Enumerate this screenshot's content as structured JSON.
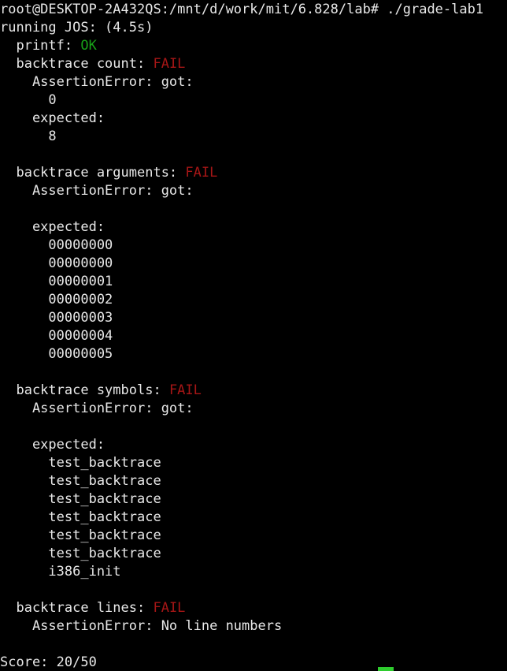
{
  "terminal": {
    "background_color": "#000000",
    "foreground_color": "#e8e8e8",
    "ok_color": "#18a018",
    "fail_color": "#a61616",
    "cursor_color": "#2ecc2e",
    "prompt": {
      "user": "root",
      "host": "DESKTOP-2A432QS",
      "path": "/mnt/d/work/mit/6.828/lab",
      "symbol": "#",
      "command": "./grade-lab1",
      "full_line": "root@DESKTOP-2A432QS:/mnt/d/work/mit/6.828/lab# ./grade-lab1"
    },
    "run_header": "running JOS: (4.5s)",
    "lines": [
      {
        "text": "root@DESKTOP-2A432QS:/mnt/d/work/mit/6.828/lab# ./grade-lab1",
        "style": "plain"
      },
      {
        "text": "running JOS: (4.5s)",
        "style": "plain"
      },
      {
        "text": "  printf: ",
        "status": "OK",
        "style": "ok"
      },
      {
        "text": "  backtrace count: ",
        "status": "FAIL",
        "style": "fail"
      },
      {
        "text": "    AssertionError: got:",
        "style": "plain"
      },
      {
        "text": "      0",
        "style": "plain"
      },
      {
        "text": "    expected:",
        "style": "plain"
      },
      {
        "text": "      8",
        "style": "plain"
      },
      {
        "text": "",
        "style": "blank"
      },
      {
        "text": "  backtrace arguments: ",
        "status": "FAIL",
        "style": "fail"
      },
      {
        "text": "    AssertionError: got:",
        "style": "plain"
      },
      {
        "text": "",
        "style": "blank"
      },
      {
        "text": "    expected:",
        "style": "plain"
      },
      {
        "text": "      00000000",
        "style": "plain"
      },
      {
        "text": "      00000000",
        "style": "plain"
      },
      {
        "text": "      00000001",
        "style": "plain"
      },
      {
        "text": "      00000002",
        "style": "plain"
      },
      {
        "text": "      00000003",
        "style": "plain"
      },
      {
        "text": "      00000004",
        "style": "plain"
      },
      {
        "text": "      00000005",
        "style": "plain"
      },
      {
        "text": "",
        "style": "blank"
      },
      {
        "text": "  backtrace symbols: ",
        "status": "FAIL",
        "style": "fail"
      },
      {
        "text": "    AssertionError: got:",
        "style": "plain"
      },
      {
        "text": "",
        "style": "blank"
      },
      {
        "text": "    expected:",
        "style": "plain"
      },
      {
        "text": "      test_backtrace",
        "style": "plain"
      },
      {
        "text": "      test_backtrace",
        "style": "plain"
      },
      {
        "text": "      test_backtrace",
        "style": "plain"
      },
      {
        "text": "      test_backtrace",
        "style": "plain"
      },
      {
        "text": "      test_backtrace",
        "style": "plain"
      },
      {
        "text": "      test_backtrace",
        "style": "plain"
      },
      {
        "text": "      i386_init",
        "style": "plain"
      },
      {
        "text": "",
        "style": "blank"
      },
      {
        "text": "  backtrace lines: ",
        "status": "FAIL",
        "style": "fail"
      },
      {
        "text": "    AssertionError: No line numbers",
        "style": "plain"
      },
      {
        "text": "",
        "style": "blank"
      },
      {
        "text": "Score: 20/50",
        "style": "plain"
      }
    ],
    "tests": [
      {
        "name": "printf",
        "result": "OK"
      },
      {
        "name": "backtrace count",
        "result": "FAIL",
        "error": "AssertionError",
        "got": [
          "0"
        ],
        "expected": [
          "8"
        ]
      },
      {
        "name": "backtrace arguments",
        "result": "FAIL",
        "error": "AssertionError",
        "got": [],
        "expected": [
          "00000000",
          "00000000",
          "00000001",
          "00000002",
          "00000003",
          "00000004",
          "00000005"
        ]
      },
      {
        "name": "backtrace symbols",
        "result": "FAIL",
        "error": "AssertionError",
        "got": [],
        "expected": [
          "test_backtrace",
          "test_backtrace",
          "test_backtrace",
          "test_backtrace",
          "test_backtrace",
          "test_backtrace",
          "i386_init"
        ]
      },
      {
        "name": "backtrace lines",
        "result": "FAIL",
        "error": "AssertionError: No line numbers",
        "got": [],
        "expected": []
      }
    ],
    "score": {
      "label": "Score:",
      "value": "20/50",
      "earned": 20,
      "total": 50,
      "full_line": "Score: 20/50"
    }
  }
}
